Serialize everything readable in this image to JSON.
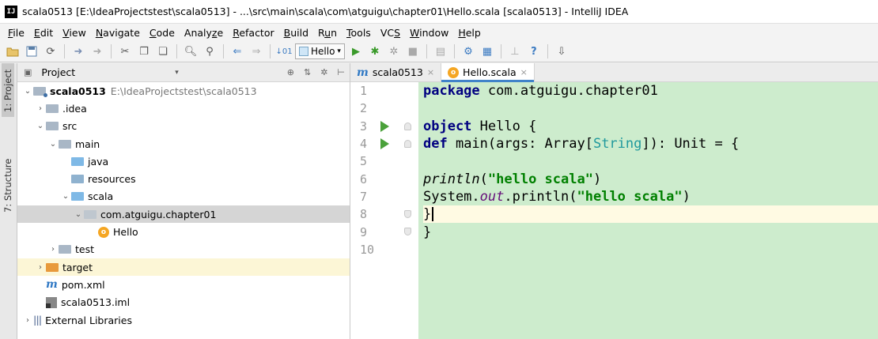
{
  "window": {
    "title": "scala0513 [E:\\IdeaProjectstest\\scala0513] - ...\\src\\main\\scala\\com\\atguigu\\chapter01\\Hello.scala [scala0513] - IntelliJ IDEA",
    "logo": "IJ"
  },
  "menu": [
    {
      "mn": "F",
      "rest": "ile"
    },
    {
      "mn": "E",
      "rest": "dit"
    },
    {
      "mn": "V",
      "rest": "iew"
    },
    {
      "mn": "N",
      "rest": "avigate"
    },
    {
      "mn": "C",
      "rest": "ode"
    },
    {
      "pre": "Analy",
      "mn": "z",
      "rest": "e"
    },
    {
      "mn": "R",
      "rest": "efactor"
    },
    {
      "mn": "B",
      "rest": "uild"
    },
    {
      "pre": "R",
      "mn": "u",
      "rest": "n"
    },
    {
      "mn": "T",
      "rest": "ools"
    },
    {
      "pre": "VC",
      "mn": "S",
      "rest": ""
    },
    {
      "mn": "W",
      "rest": "indow"
    },
    {
      "mn": "H",
      "rest": "elp"
    }
  ],
  "toolbar": {
    "run_config": "Hello"
  },
  "side_tabs": {
    "project": "1: Project",
    "structure": "7: Structure"
  },
  "project_panel": {
    "title": "Project",
    "tree": {
      "root": {
        "name": "scala0513",
        "path": "E:\\IdeaProjectstest\\scala0513"
      },
      "idea": ".idea",
      "src": "src",
      "main": "main",
      "java": "java",
      "resources": "resources",
      "scala": "scala",
      "package": "com.atguigu.chapter01",
      "hello": "Hello",
      "test": "test",
      "target": "target",
      "pom": "pom.xml",
      "iml": "scala0513.iml",
      "libs": "External Libraries"
    }
  },
  "editor": {
    "tabs": [
      {
        "label": "scala0513"
      },
      {
        "label": "Hello.scala"
      }
    ],
    "code": {
      "l1_kw": "package",
      "l1_rest": " com.atguigu.chapter01",
      "l3_kw": "object",
      "l3_rest": " Hello {",
      "l4_kw": "def",
      "l4_a": " main(args: Array[",
      "l4_type": "String",
      "l4_b": "]): Unit = {",
      "l6_fn": "println",
      "l6_a": "(",
      "l6_str": "\"hello scala\"",
      "l6_b": ")",
      "l7_a": "System.",
      "l7_field": "out",
      "l7_b": ".println(",
      "l7_str": "\"hello scala\"",
      "l7_c": ")",
      "l8": "}",
      "l9": "}"
    },
    "line_numbers": [
      "1",
      "2",
      "3",
      "4",
      "5",
      "6",
      "7",
      "8",
      "9",
      "10"
    ]
  }
}
